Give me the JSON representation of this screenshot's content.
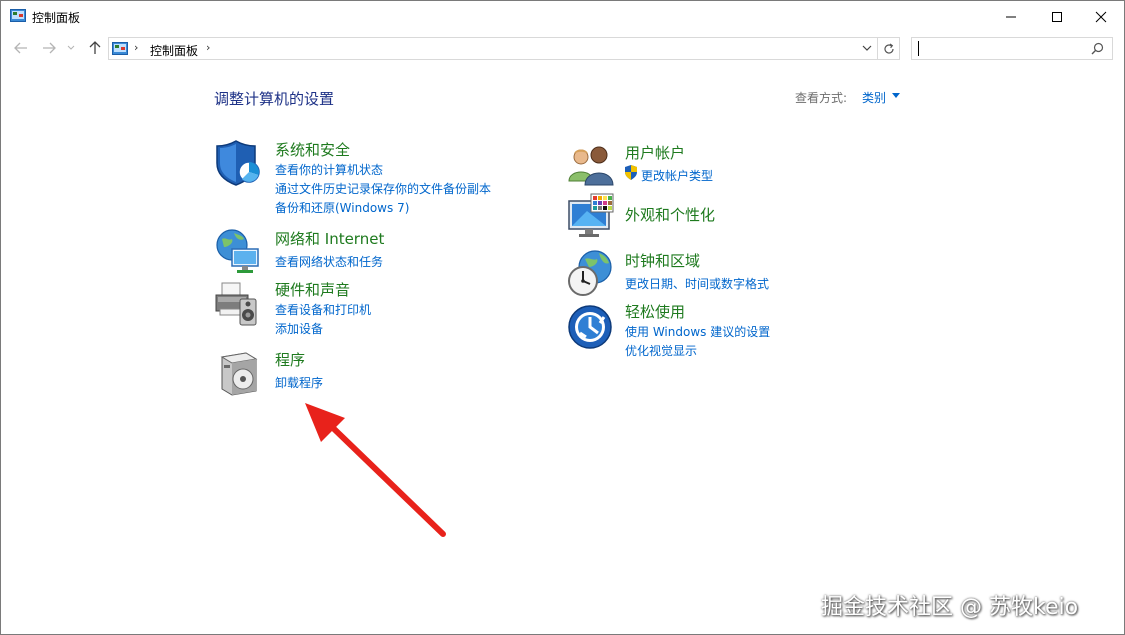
{
  "window": {
    "title": "控制面板",
    "icons": {
      "app": "control-panel-icon",
      "minimize": "minimize-icon",
      "maximize": "maximize-icon",
      "close": "close-icon"
    }
  },
  "address_bar": {
    "breadcrumb": "控制面板",
    "separator": "›",
    "icons": {
      "back": "back-arrow-icon",
      "forward": "forward-arrow-icon",
      "recent": "chevron-down-icon",
      "up": "up-arrow-icon",
      "dropdown": "chevron-down-icon",
      "refresh": "refresh-icon"
    }
  },
  "search": {
    "value": "",
    "icon": "search-icon"
  },
  "header": {
    "title": "调整计算机的设置",
    "view_by_label": "查看方式:",
    "view_by_value": "类别"
  },
  "categories": {
    "system": {
      "title": "系统和安全",
      "links": [
        "查看你的计算机状态",
        "通过文件历史记录保存你的文件备份副本",
        "备份和还原(Windows 7)"
      ],
      "icon": "shield-icon"
    },
    "network": {
      "title": "网络和 Internet",
      "links": [
        "查看网络状态和任务"
      ],
      "icon": "network-globe-icon"
    },
    "hardware": {
      "title": "硬件和声音",
      "links": [
        "查看设备和打印机",
        "添加设备"
      ],
      "icon": "printer-speaker-icon"
    },
    "programs": {
      "title": "程序",
      "links": [
        "卸载程序"
      ],
      "icon": "programs-disc-icon"
    },
    "users": {
      "title": "用户帐户",
      "links": [
        "更改帐户类型"
      ],
      "icon": "users-icon"
    },
    "appearance": {
      "title": "外观和个性化",
      "links": [],
      "icon": "monitor-palette-icon"
    },
    "clock": {
      "title": "时钟和区域",
      "links": [
        "更改日期、时间或数字格式"
      ],
      "icon": "clock-globe-icon"
    },
    "ease": {
      "title": "轻松使用",
      "links": [
        "使用 Windows 建议的设置",
        "优化视觉显示"
      ],
      "icon": "ease-of-access-icon"
    }
  },
  "colors": {
    "category_title": "#1e7a1e",
    "link": "#0066cc",
    "page_title": "#1e3287",
    "annotation_arrow": "#e8221b"
  },
  "watermark": "掘金技术社区 @ 苏牧keio"
}
